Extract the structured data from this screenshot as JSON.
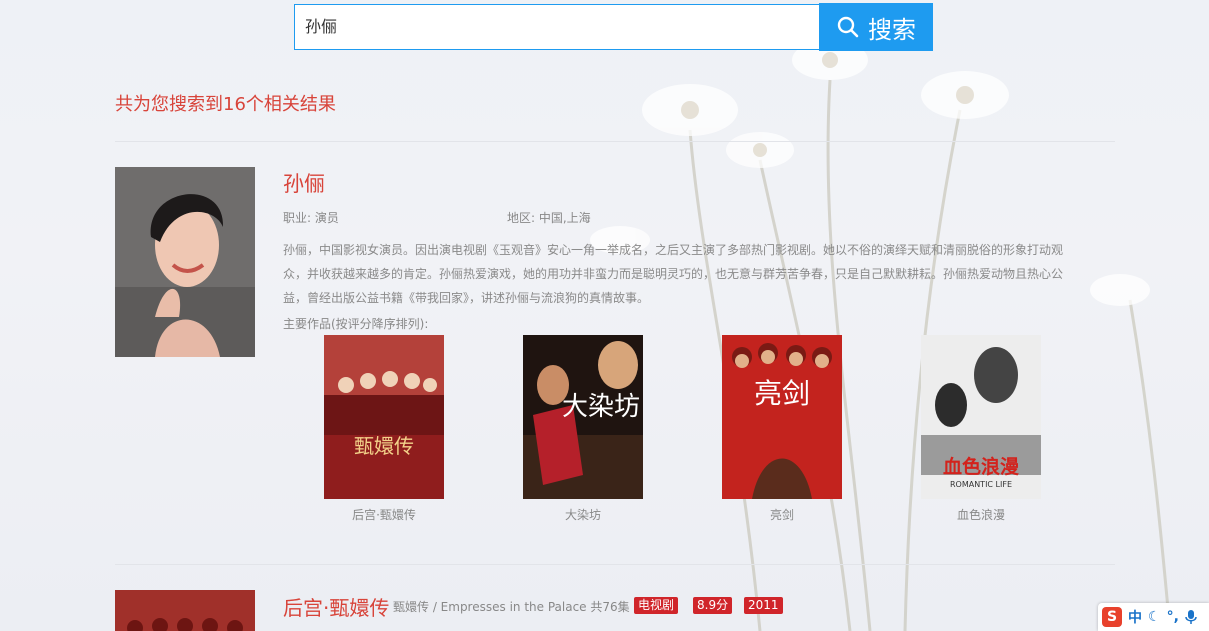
{
  "search": {
    "query": "孙俪",
    "button_label": "搜索"
  },
  "results": {
    "summary": "共为您搜索到16个相关结果"
  },
  "person": {
    "name": "孙俪",
    "occupation": "职业: 演员",
    "region": "地区: 中国,上海",
    "bio": "孙俪，中国影视女演员。因出演电视剧《玉观音》安心一角一举成名，之后又主演了多部热门影视剧。她以不俗的演绎天赋和清丽脱俗的形象打动观众，并收获越来越多的肯定。孙俪热爱演戏，她的用功并非蛮力而是聪明灵巧的，也无意与群芳苦争春，只是自己默默耕耘。孙俪热爱动物且热心公益，曾经出版公益书籍《带我回家》，讲述孙俪与流浪狗的真情故事。",
    "works_label": "主要作品(按评分降序排列):",
    "works": [
      {
        "title": "后宫·甄嬛传",
        "poster_text": "甄嬛传"
      },
      {
        "title": "大染坊",
        "poster_text": "大染坊"
      },
      {
        "title": "亮剑",
        "poster_text": "亮剑"
      },
      {
        "title": "血色浪漫",
        "poster_text": "血色浪漫",
        "poster_subtext": "ROMANTIC LIFE"
      }
    ]
  },
  "show": {
    "title": "后宫·甄嬛传",
    "subtitle": "甄嬛传 / Empresses in the Palace 共76集",
    "badges": [
      "电视剧",
      "8.9分",
      "2011"
    ]
  },
  "ime": {
    "logo": "S",
    "mode": "中",
    "extra": "°,"
  },
  "colors": {
    "accent": "#1e9bf0",
    "highlight": "#d8443a",
    "badge": "#d0252a"
  }
}
